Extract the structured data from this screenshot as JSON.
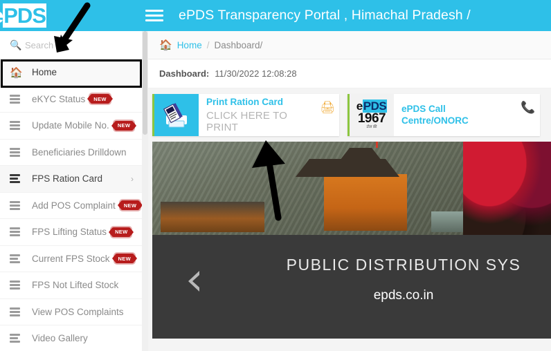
{
  "header": {
    "logo_text_prefix": "e",
    "logo_text_highlight": "PDS",
    "menu_icon": "hamburger-icon",
    "portal_title": "ePDS Transparency Portal , Himachal Pradesh /"
  },
  "sidebar": {
    "search": {
      "icon": "search-icon",
      "placeholder": "Search",
      "value": ""
    },
    "items": [
      {
        "label": "Home",
        "icon": "home-icon",
        "badge": "",
        "chevron": false,
        "active": true
      },
      {
        "label": "eKYC Status",
        "icon": "server-icon",
        "badge": "NEW",
        "chevron": false,
        "active": false
      },
      {
        "label": "Update Mobile No.",
        "icon": "server-icon",
        "badge": "NEW",
        "chevron": false,
        "active": false
      },
      {
        "label": "Beneficiaries Drilldown",
        "icon": "server-icon",
        "badge": "",
        "chevron": false,
        "active": false
      },
      {
        "label": "FPS Ration Card",
        "icon": "bars-icon",
        "badge": "",
        "chevron": true,
        "active": true
      },
      {
        "label": "Add POS Complaint",
        "icon": "server-icon",
        "badge": "NEW",
        "chevron": false,
        "active": false
      },
      {
        "label": "FPS Lifting Status",
        "icon": "server-icon",
        "badge": "NEW",
        "chevron": false,
        "active": false
      },
      {
        "label": "Current FPS Stock",
        "icon": "bars-icon",
        "badge": "NEW",
        "chevron": false,
        "active": false
      },
      {
        "label": "FPS Not Lifted Stock",
        "icon": "server-icon",
        "badge": "",
        "chevron": false,
        "active": false
      },
      {
        "label": "View POS Complaints",
        "icon": "server-icon",
        "badge": "",
        "chevron": false,
        "active": false
      },
      {
        "label": "Video Gallery",
        "icon": "bars-icon",
        "badge": "",
        "chevron": false,
        "active": false
      }
    ]
  },
  "breadcrumb": {
    "home_icon": "home-icon",
    "home": "Home",
    "separator": "/",
    "current": "Dashboard/"
  },
  "dashboard": {
    "label": "Dashboard:",
    "timestamp": "11/30/2022 12:08:28"
  },
  "cards": [
    {
      "icon": "printer-card-icon",
      "title": "Print Ration Card",
      "subtitle": "CLICK HERE TO PRINT",
      "corner_icon": "printer-icon"
    },
    {
      "icon": "epds-1967-logo",
      "logo_prefix": "e",
      "logo_highlight": "PDS",
      "logo_number": "1967",
      "logo_hindi": "टोल फ्री",
      "title_line1": "ePDS Call",
      "title_line2": "Centre/ONORC",
      "corner_icon": "phone-icon"
    }
  ],
  "banner": {
    "alt": "himachal-temple-and-grains-photo"
  },
  "slider": {
    "prev_icon": "chevron-left-icon",
    "headline": "PUBLIC DISTRIBUTION SYS",
    "url": "epds.co.in"
  },
  "colors": {
    "brand_cyan": "#2ec0e8",
    "accent_green": "#8cc63f",
    "badge_red": "#b71c1c",
    "slider_dark": "#3a3a3a"
  }
}
